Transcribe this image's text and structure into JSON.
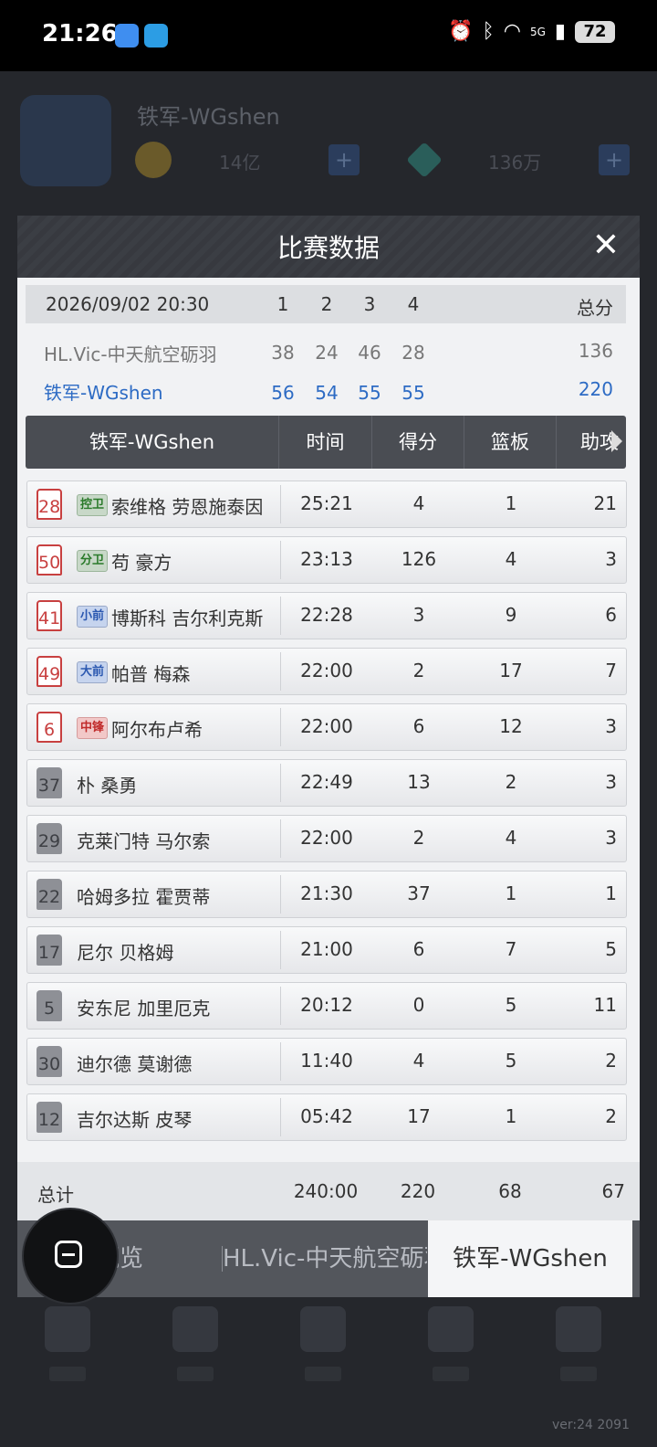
{
  "status_bar": {
    "time": "21:26",
    "signal_label": "5G",
    "battery": "72"
  },
  "background": {
    "team_name": "铁军-WGshen",
    "currency1": "14亿",
    "currency2": "136万",
    "version": "ver:24  2091"
  },
  "modal": {
    "title": "比赛数据",
    "close_icon": "close-icon"
  },
  "scoreboard": {
    "datetime": "2026/09/02 20:30",
    "quarters": [
      "1",
      "2",
      "3",
      "4"
    ],
    "total_label": "总分",
    "teams": [
      {
        "name": "HL.Vic-中天航空砺羽",
        "q": [
          "38",
          "24",
          "46",
          "28"
        ],
        "total": "136"
      },
      {
        "name": "铁军-WGshen",
        "q": [
          "56",
          "54",
          "55",
          "55"
        ],
        "total": "220"
      }
    ]
  },
  "stats": {
    "team_header": "铁军-WGshen",
    "columns": [
      "时间",
      "得分",
      "篮板",
      "助攻"
    ],
    "players": [
      {
        "number": "28",
        "pos": "控卫",
        "pos_color": "g",
        "starter": true,
        "name": "索维格 劳恩施泰因",
        "time": "25:21",
        "pts": "4",
        "reb": "1",
        "ast": "21"
      },
      {
        "number": "50",
        "pos": "分卫",
        "pos_color": "g",
        "starter": true,
        "name": "苟 豪方",
        "time": "23:13",
        "pts": "126",
        "reb": "4",
        "ast": "3"
      },
      {
        "number": "41",
        "pos": "小前",
        "pos_color": "b",
        "starter": true,
        "name": "博斯科 吉尔利克斯",
        "time": "22:28",
        "pts": "3",
        "reb": "9",
        "ast": "6"
      },
      {
        "number": "49",
        "pos": "大前",
        "pos_color": "b",
        "starter": true,
        "name": "帕普 梅森",
        "time": "22:00",
        "pts": "2",
        "reb": "17",
        "ast": "7"
      },
      {
        "number": "6",
        "pos": "中锋",
        "pos_color": "r",
        "starter": true,
        "name": "阿尔布卢希",
        "time": "22:00",
        "pts": "6",
        "reb": "12",
        "ast": "3"
      },
      {
        "number": "37",
        "pos": "",
        "starter": false,
        "name": "朴 桑勇",
        "time": "22:49",
        "pts": "13",
        "reb": "2",
        "ast": "3"
      },
      {
        "number": "29",
        "pos": "",
        "starter": false,
        "name": "克莱门特 马尔索",
        "time": "22:00",
        "pts": "2",
        "reb": "4",
        "ast": "3"
      },
      {
        "number": "22",
        "pos": "",
        "starter": false,
        "name": "哈姆多拉 霍贾蒂",
        "time": "21:30",
        "pts": "37",
        "reb": "1",
        "ast": "1"
      },
      {
        "number": "17",
        "pos": "",
        "starter": false,
        "name": "尼尔 贝格姆",
        "time": "21:00",
        "pts": "6",
        "reb": "7",
        "ast": "5"
      },
      {
        "number": "5",
        "pos": "",
        "starter": false,
        "name": "安东尼 加里厄克",
        "time": "20:12",
        "pts": "0",
        "reb": "5",
        "ast": "11"
      },
      {
        "number": "30",
        "pos": "",
        "starter": false,
        "name": "迪尔德 莫谢德",
        "time": "11:40",
        "pts": "4",
        "reb": "5",
        "ast": "2"
      },
      {
        "number": "12",
        "pos": "",
        "starter": false,
        "name": "吉尔达斯 皮琴",
        "time": "05:42",
        "pts": "17",
        "reb": "1",
        "ast": "2"
      }
    ],
    "totals": {
      "label": "总计",
      "time": "240:00",
      "pts": "220",
      "reb": "68",
      "ast": "67"
    }
  },
  "tabs": [
    {
      "label": "概览",
      "active": false
    },
    {
      "label": "HL.Vic-中天航空砺羽",
      "active": false
    },
    {
      "label": "铁军-WGshen",
      "active": true
    }
  ]
}
